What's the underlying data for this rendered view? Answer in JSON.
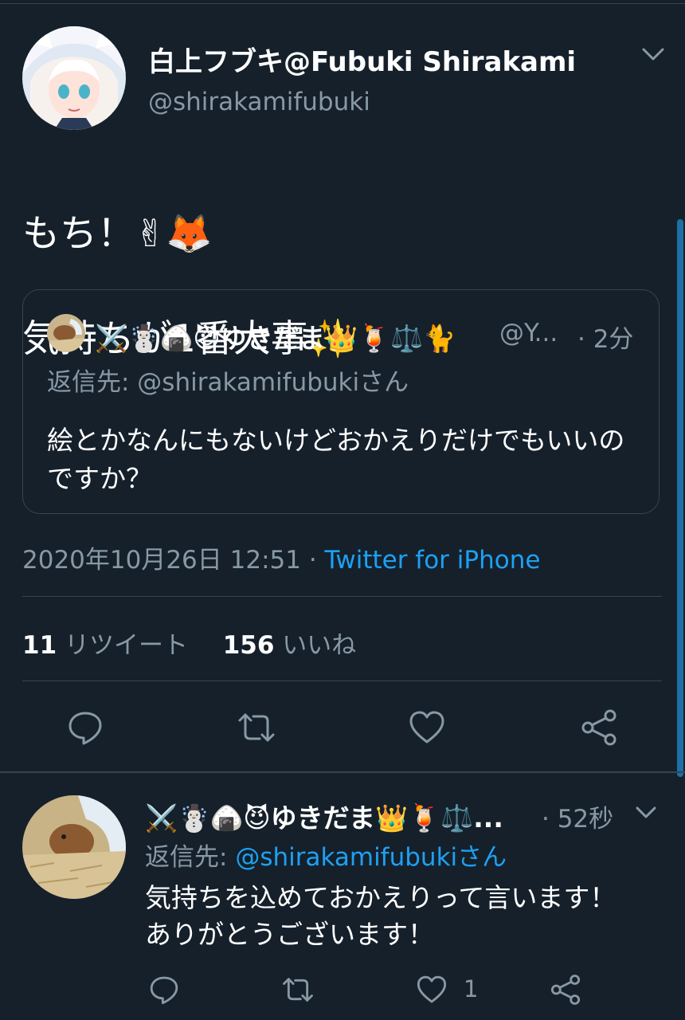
{
  "colors": {
    "background": "#15202b",
    "border": "#38444d",
    "secondary_text": "#8899a6",
    "accent": "#1da1f2"
  },
  "main_tweet": {
    "display_name": "白上フブキ@Fubuki Shirakami",
    "handle": "@shirakamifubuki",
    "text_line1": "もち！✌🦊",
    "text_line2": "気持ちが1番大事✨",
    "quoted": {
      "display_name": "⚔️☃️🍙😈ゆきだま👑🍹⚖️🐈",
      "handle": "@Y...",
      "time": "· 2分",
      "reply_to": "返信先: @shirakamifubukiさん",
      "text": "絵とかなんにもないけどおかえりだけでもいいのですか？"
    },
    "timestamp": "2020年10月26日 12:51",
    "separator": " · ",
    "source": "Twitter for iPhone",
    "retweet_count": "11",
    "retweet_label": "リツイート",
    "like_count": "156",
    "like_label": "いいね",
    "actions": [
      "reply-icon",
      "retweet-icon",
      "like-icon",
      "share-icon"
    ]
  },
  "reply_tweet": {
    "display_name": "⚔️☃️🍙😈ゆきだま👑🍹⚖️...",
    "time": "· 52秒",
    "reply_prefix": "返信先: ",
    "reply_mention": "@shirakamifubukiさん",
    "text_line1": "気持ちを込めておかえりって言います！",
    "text_line2": "ありがとうございます！",
    "like_count": "1",
    "actions": [
      "reply-icon",
      "retweet-icon",
      "like-icon",
      "share-icon"
    ]
  }
}
